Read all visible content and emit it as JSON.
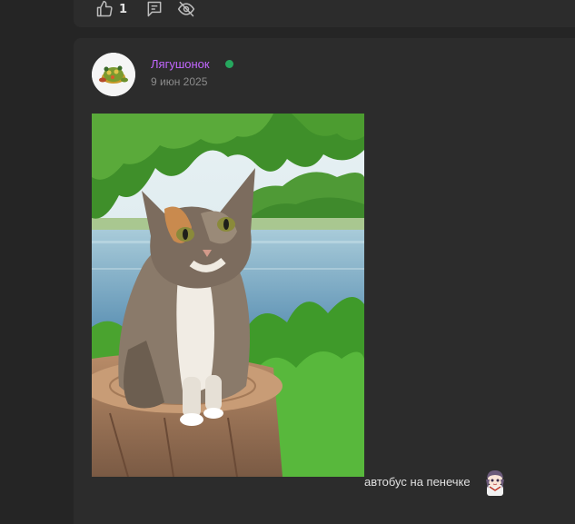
{
  "previous_post": {
    "like_count": "1",
    "icons": [
      "thumbs-up-icon",
      "comment-icon",
      "eye-off-icon"
    ]
  },
  "post": {
    "author": {
      "name": "Лягушонок",
      "online": true,
      "avatar_icon": "frog-turtle-avatar"
    },
    "date": "9 июн 2025",
    "image": "cat-on-tree-stump-photo",
    "caption": "автобус на пенечке",
    "sticker": "anime-girl-sticker"
  },
  "colors": {
    "background": "#252525",
    "card": "#2c2c2c",
    "username": "#c266ff",
    "online": "#26a75e",
    "date": "#8c8c8c"
  }
}
